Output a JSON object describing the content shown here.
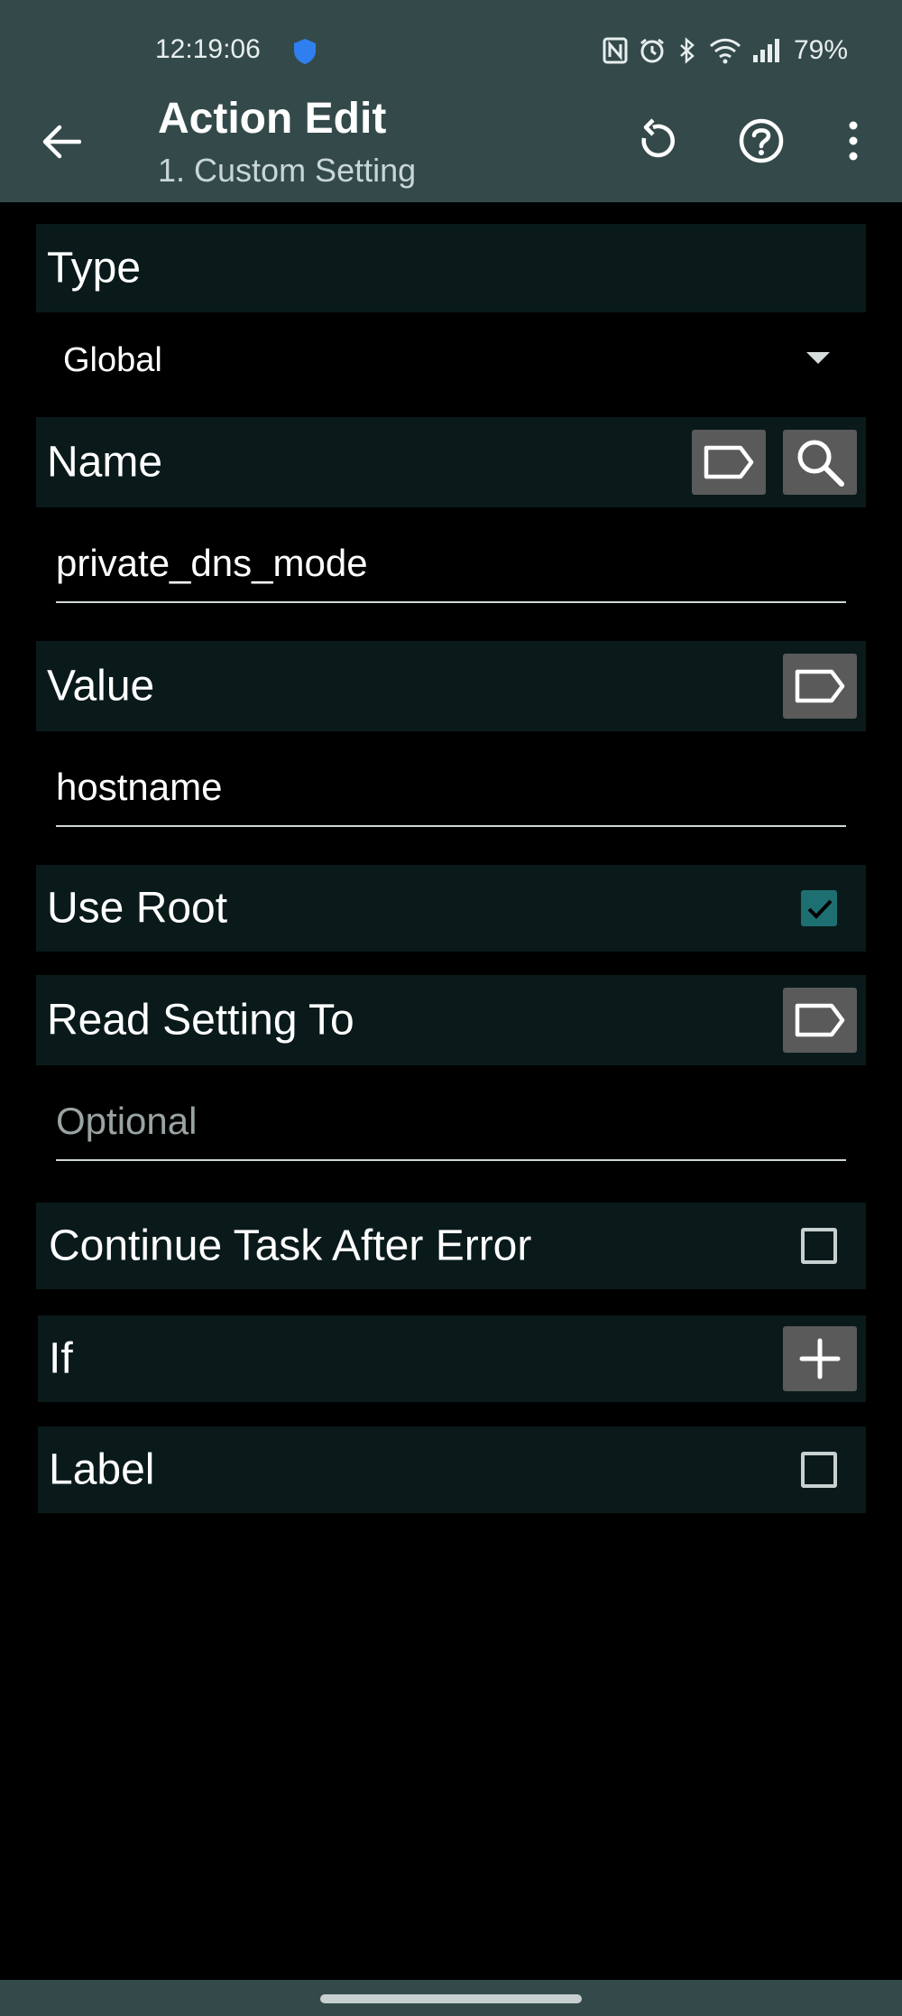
{
  "status_bar": {
    "time": "12:19:06",
    "battery": "79%",
    "icons": [
      "shield-icon",
      "nfc-icon",
      "alarm-icon",
      "bluetooth-icon",
      "wifi-icon",
      "signal-icon"
    ],
    "shield_color": "#2f7ff0"
  },
  "header": {
    "title": "Action Edit",
    "subtitle": "1. Custom Setting",
    "icons": [
      "back-arrow-icon",
      "undo-icon",
      "help-icon",
      "overflow-menu-icon"
    ],
    "background": "#344a4a"
  },
  "type_section": {
    "label": "Type",
    "selected": "Global"
  },
  "name_section": {
    "label": "Name",
    "value": "private_dns_mode",
    "icons": [
      "tag-icon",
      "search-icon"
    ]
  },
  "value_section": {
    "label": "Value",
    "value": "hostname",
    "icons": [
      "tag-icon"
    ]
  },
  "use_root": {
    "label": "Use Root",
    "checked": true
  },
  "read_setting": {
    "label": "Read Setting To",
    "placeholder": "Optional",
    "icons": [
      "tag-icon"
    ]
  },
  "continue_task": {
    "label": "Continue Task After Error",
    "checked": false
  },
  "if_section": {
    "label": "If",
    "icons": [
      "plus-icon"
    ]
  },
  "label_section": {
    "label": "Label",
    "checked": false
  },
  "colors": {
    "section_bg": "#0a1a1a",
    "button_bg": "#5a5a5a",
    "checkbox_checked": "#1e6f72"
  }
}
